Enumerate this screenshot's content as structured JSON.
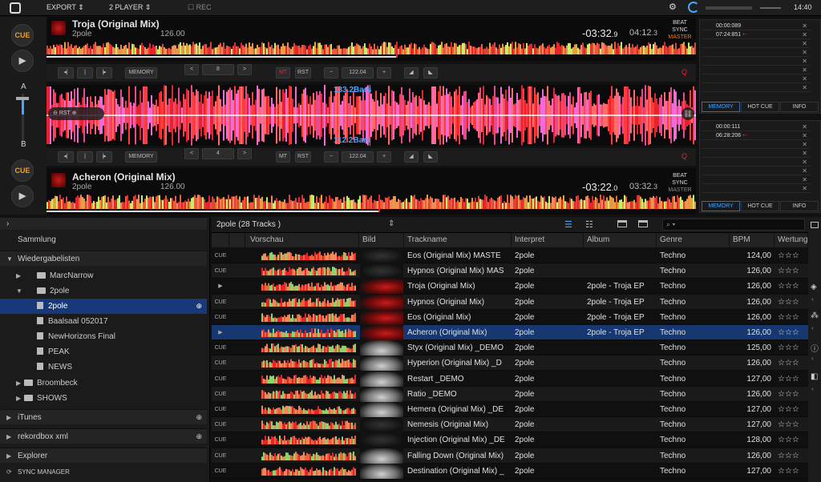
{
  "topbar": {
    "export": "EXPORT",
    "player": "2 PLAYER",
    "rec": "REC",
    "clock": "14:40"
  },
  "left": {
    "cue": "CUE",
    "ch_a": "A",
    "ch_b": "B"
  },
  "deck1": {
    "title": "Troja (Original Mix)",
    "artist": "2pole",
    "bpm": "126.00",
    "remain": "-03:32",
    "remain_frac": ".9",
    "elapsed": "04:12",
    "elapsed_frac": ".3",
    "beat": "BEAT",
    "sync": "SYNC",
    "master": "MASTER"
  },
  "deck2": {
    "title": "Acheron (Original Mix)",
    "artist": "2pole",
    "bpm": "126.00",
    "remain": "-03:22",
    "remain_frac": ".0",
    "elapsed": "03:32",
    "elapsed_frac": ".3",
    "beat": "BEAT",
    "sync": "SYNC",
    "master": "MASTER"
  },
  "ctrl1": {
    "memory": "MEMORY",
    "beatjump": "8",
    "mt": "MT",
    "rst": "RST",
    "tempo": "122.04",
    "q": "Q"
  },
  "ctrl2": {
    "memory": "MEMORY",
    "beatjump": "4",
    "mt": "MT",
    "rst": "RST",
    "tempo": "122.04",
    "q": "Q"
  },
  "bigwave": {
    "bars_top": "133.2Bars",
    "bars_bottom": "112.2Bars",
    "rst": "RST"
  },
  "mem1": {
    "rows": [
      "00:00:089",
      "07:24:851"
    ],
    "tabs": [
      "MEMORY",
      "HOT CUE",
      "INFO"
    ]
  },
  "mem2": {
    "rows": [
      "00:00:111",
      "06:28:206"
    ],
    "tabs": [
      "MEMORY",
      "HOT CUE",
      "INFO"
    ]
  },
  "tree": {
    "collection": "Sammlung",
    "playlists": "Wiedergabelisten",
    "items": [
      "MarcNarrow",
      "2pole",
      "2pole",
      "Baalsaal 052017",
      "NewHorizons Final",
      "PEAK",
      "NEWS",
      "Broombeck",
      "SHOWS"
    ],
    "itunes": "iTunes",
    "rekordbox_xml": "rekordbox xml",
    "explorer": "Explorer",
    "sync_manager": "SYNC MANAGER"
  },
  "table": {
    "header_title": "2pole (28 Tracks )",
    "columns": [
      "Vorschau",
      "Bild",
      "Trackname",
      "Interpret",
      "Album",
      "Genre",
      "BPM",
      "Wertung"
    ],
    "rows": [
      {
        "status": "CUE",
        "name": "Eos (Original Mix) MASTE",
        "artist": "2pole",
        "album": "",
        "genre": "Techno",
        "bpm": "124,00",
        "thumb": "dark"
      },
      {
        "status": "CUE",
        "name": "Hypnos (Original Mix) MAS",
        "artist": "2pole",
        "album": "",
        "genre": "Techno",
        "bpm": "126,00",
        "thumb": "dark"
      },
      {
        "status": "▶",
        "name": "Troja (Original Mix)",
        "artist": "2pole",
        "album": "2pole - Troja EP",
        "genre": "Techno",
        "bpm": "126,00",
        "thumb": "red"
      },
      {
        "status": "CUE",
        "name": "Hypnos (Original Mix)",
        "artist": "2pole",
        "album": "2pole - Troja EP",
        "genre": "Techno",
        "bpm": "126,00",
        "thumb": "red"
      },
      {
        "status": "CUE",
        "name": "Eos (Original Mix)",
        "artist": "2pole",
        "album": "2pole - Troja EP",
        "genre": "Techno",
        "bpm": "126,00",
        "thumb": "red"
      },
      {
        "status": "▶",
        "name": "Acheron (Original Mix)",
        "artist": "2pole",
        "album": "2pole - Troja EP",
        "genre": "Techno",
        "bpm": "126,00",
        "thumb": "red"
      },
      {
        "status": "CUE",
        "name": "Styx (Original Mix) _DEMO",
        "artist": "2pole",
        "album": "",
        "genre": "Techno",
        "bpm": "125,00",
        "thumb": "grey"
      },
      {
        "status": "CUE",
        "name": "Hyperion (Original Mix) _D",
        "artist": "2pole",
        "album": "",
        "genre": "Techno",
        "bpm": "126,00",
        "thumb": "grey"
      },
      {
        "status": "CUE",
        "name": "Restart _DEMO",
        "artist": "2pole",
        "album": "",
        "genre": "Techno",
        "bpm": "127,00",
        "thumb": "grey"
      },
      {
        "status": "CUE",
        "name": "Ratio _DEMO",
        "artist": "2pole",
        "album": "",
        "genre": "Techno",
        "bpm": "126,00",
        "thumb": "grey"
      },
      {
        "status": "CUE",
        "name": "Hemera (Original Mix) _DE",
        "artist": "2pole",
        "album": "",
        "genre": "Techno",
        "bpm": "127,00",
        "thumb": "grey"
      },
      {
        "status": "CUE",
        "name": "Nemesis (Original Mix)",
        "artist": "2pole",
        "album": "",
        "genre": "Techno",
        "bpm": "127,00",
        "thumb": "dark"
      },
      {
        "status": "CUE",
        "name": "Injection (Original Mix) _DE",
        "artist": "2pole",
        "album": "",
        "genre": "Techno",
        "bpm": "128,00",
        "thumb": "dark"
      },
      {
        "status": "CUE",
        "name": "Falling Down (Original Mix)",
        "artist": "2pole",
        "album": "",
        "genre": "Techno",
        "bpm": "126,00",
        "thumb": "grey"
      },
      {
        "status": "CUE",
        "name": "Destination (Original Mix) _",
        "artist": "2pole",
        "album": "",
        "genre": "Techno",
        "bpm": "127,00",
        "thumb": "grey"
      }
    ],
    "stars": "☆☆☆"
  },
  "colors": {
    "accent": "#4aa3ff",
    "cue": "#e8a13a",
    "selection": "#16376f",
    "wave_red": "#e8232b",
    "wave_pink": "#f06bd8"
  }
}
